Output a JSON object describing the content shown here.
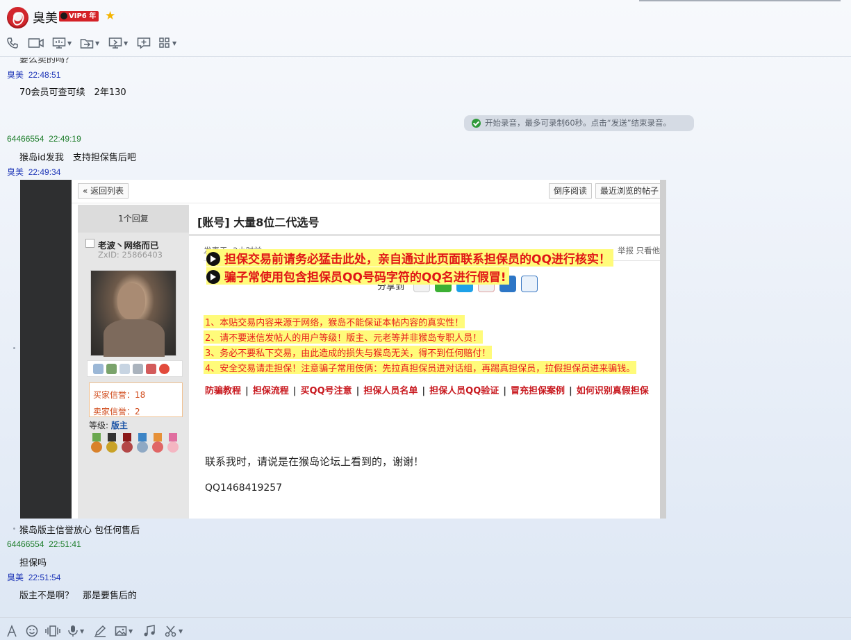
{
  "header": {
    "contact_name": "臭美",
    "vip_badge": "VIP6 年",
    "star_icon": "star-icon"
  },
  "toolbar_icons": [
    "phone-icon",
    "video-icon",
    "screen-share-icon",
    "file-transfer-icon",
    "remote-desktop-icon",
    "chat-bubble-add-icon",
    "apps-grid-icon"
  ],
  "messages": {
    "cutoff_text": "要么卖的吗？",
    "m1": {
      "sender": "臭美",
      "time": "22:48:51",
      "text": "70会员可查可续　2年130"
    },
    "system_note": "开始录音，最多可录制60秒。点击“发送”结束录音。",
    "m2": {
      "sender": "64466554",
      "time": "22:49:19",
      "text": "猴岛id发我　支持担保售后吧"
    },
    "m3": {
      "sender": "臭美",
      "time": "22:49:34",
      "caption": "猴岛版主信誉放心  包任何售后"
    },
    "m4": {
      "sender": "64466554",
      "time": "22:51:41",
      "text": "担保吗"
    },
    "m5": {
      "sender": "臭美",
      "time": "22:51:54",
      "text": "版主不是啊？　那是要售后的"
    }
  },
  "forum": {
    "back_btn": "« 返回列表",
    "reverse_btn": "倒序阅读",
    "recent_btn": "最近浏览的帖子",
    "replies": "1个回复",
    "title": "[账号] 大量8位二代选号",
    "username": "老波丶网络而已",
    "zxid": "ZxID:  25866403",
    "posted": "发表于: 3小时前",
    "report": "举报   只看他",
    "buyer_credit": "买家信誉：18",
    "seller_credit": "卖家信誉：2",
    "rank_label": "等级:",
    "rank_value": "版主",
    "share_label": "分享到",
    "share_icons": [
      "qq-share-icon",
      "wechat-share-icon",
      "pengyou-share-icon",
      "weibo-share-icon",
      "qzone-share-icon",
      "tieba-share-icon"
    ],
    "warnings": [
      "1、本贴交易内容来源于网络，猴岛不能保证本帖内容的真实性！",
      "2、请不要迷信发帖人的用户等级！版主、元老等并非猴岛专职人员！",
      "3、务必不要私下交易，由此造成的损失与猴岛无关，得不到任何赔付！",
      "4、安全交易请走担保！注意骗子常用伎俩：先拉真担保员进对话组，再踢真担保员，拉假担保员进来骗钱。"
    ],
    "links": [
      "防骗教程",
      "担保流程",
      "买QQ号注意",
      "担保人员名单",
      "担保人员QQ验证",
      "冒充担保案例",
      "如何识别真假担保"
    ],
    "big1": "担保交易前请务必猛击此处，亲自通过此页面联系担保员的QQ进行核实！",
    "big2": "骗子常使用包含担保员QQ号码字符的QQ名进行假冒!",
    "contact": "联系我时，请说是在猴岛论坛上看到的，谢谢！",
    "qq": "QQ1468419257"
  },
  "input_toolbar_icons": [
    "font-icon",
    "emoji-icon",
    "shake-icon",
    "voice-icon",
    "pen-icon",
    "image-icon",
    "music-icon",
    "scissors-icon"
  ]
}
